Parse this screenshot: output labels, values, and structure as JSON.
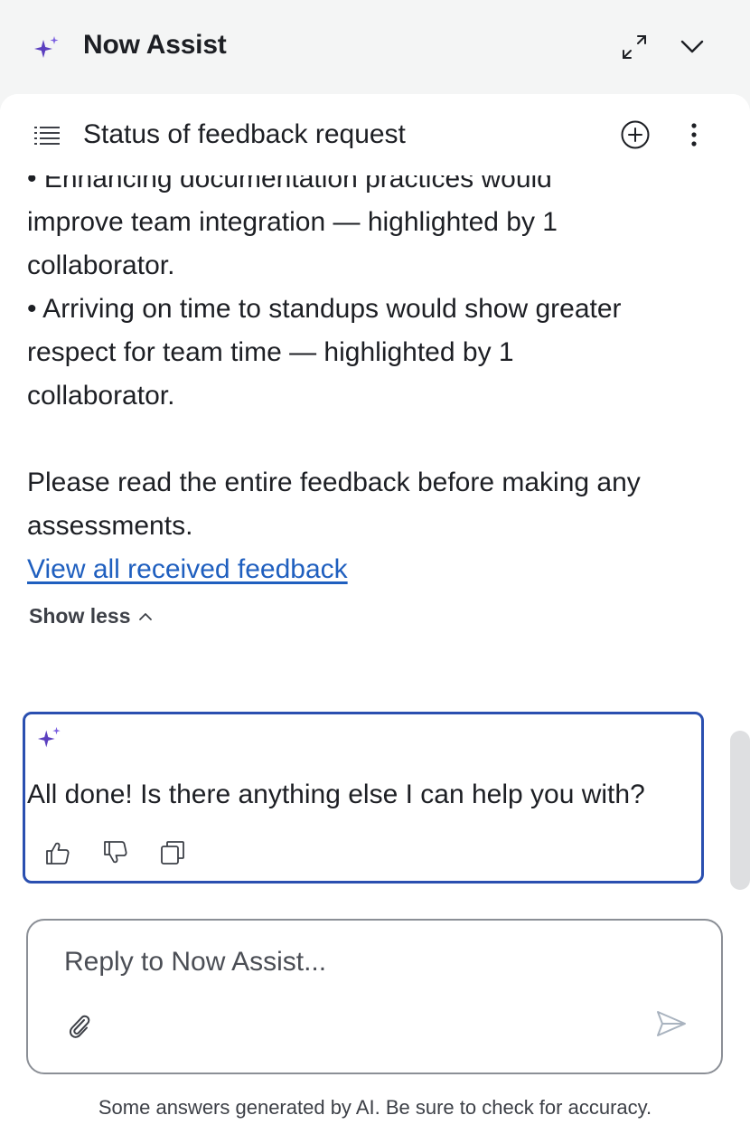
{
  "app": {
    "title": "Now Assist"
  },
  "conversation": {
    "title": "Status of feedback request"
  },
  "message": {
    "partial_line": "• Enhancing documentation practices would",
    "line_1_cont": "improve team integration — highlighted by 1",
    "line_1_end": "collaborator.",
    "bullet_2": "• Arriving on time to standups would show greater",
    "bullet_2_cont": "respect for team time — highlighted by 1",
    "bullet_2_end": "collaborator.",
    "note_1": "Please read the entire feedback before making any",
    "note_2": "assessments.",
    "link_text": "View all received feedback",
    "show_less": "Show less"
  },
  "ai_reply": {
    "text": "All done! Is there anything else I can help you with?"
  },
  "composer": {
    "placeholder": "Reply to Now Assist..."
  },
  "footer": {
    "disclaimer": "Some answers generated by AI. Be sure to check for accuracy."
  },
  "colors": {
    "accent": "#5b3fbf",
    "link": "#1f5fbf",
    "card_border": "#2a4fb0"
  },
  "icons": [
    "sparkle-icon",
    "expand-icon",
    "chevron-down-icon",
    "list-icon",
    "add-icon",
    "more-icon",
    "chevron-up-icon",
    "thumbs-up-icon",
    "thumbs-down-icon",
    "copy-icon",
    "paperclip-icon",
    "send-icon"
  ]
}
